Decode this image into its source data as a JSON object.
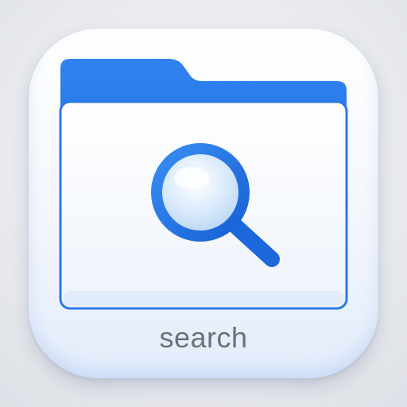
{
  "app_icon": {
    "label": "search",
    "glyph": "folder-search-icon",
    "accent_color": "#1f6fe0",
    "folder_body_color": "#f3f6fc",
    "label_color": "#6b7079"
  }
}
